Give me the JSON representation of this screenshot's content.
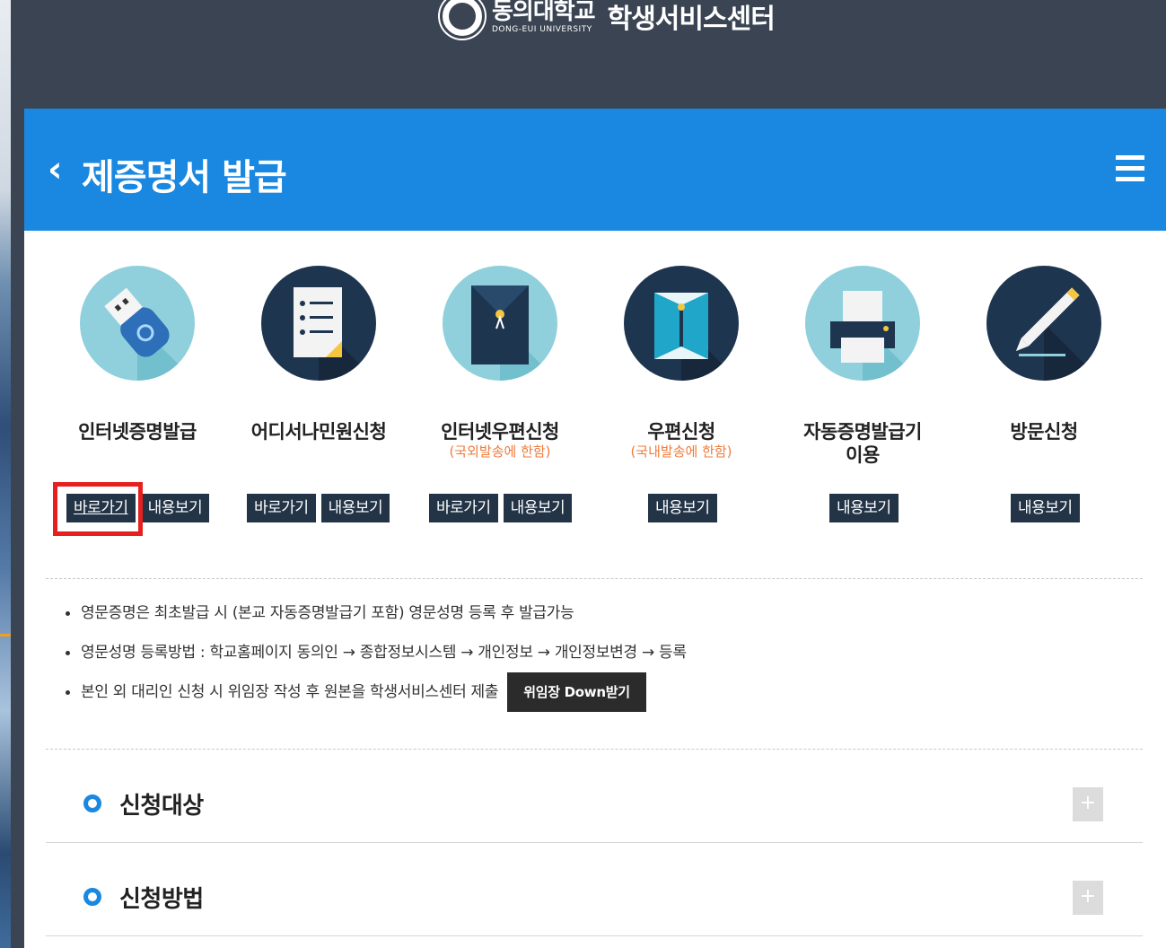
{
  "header": {
    "university_ko": "동의대학교",
    "university_en": "DONG-EUI UNIVERSITY",
    "center_name": "학생서비스센터"
  },
  "title_bar": {
    "title": "제증명서 발급"
  },
  "services": [
    {
      "name": "인터넷증명발급",
      "sub": "",
      "buttons": [
        "바로가기",
        "내용보기"
      ],
      "icon": "usb-drive-icon"
    },
    {
      "name": "어디서나민원신청",
      "sub": "",
      "buttons": [
        "바로가기",
        "내용보기"
      ],
      "icon": "document-list-icon"
    },
    {
      "name": "인터넷우편신청",
      "sub": "(국외발송에 한함)",
      "buttons": [
        "바로가기",
        "내용보기"
      ],
      "icon": "envelope-icon"
    },
    {
      "name": "우편신청",
      "sub": "(국내발송에 한함)",
      "buttons": [
        "내용보기"
      ],
      "icon": "open-envelope-icon"
    },
    {
      "name": "자동증명발급기 이용",
      "name_line1": "자동증명발급기",
      "name_line2": "이용",
      "sub": "",
      "buttons": [
        "내용보기"
      ],
      "icon": "printer-icon"
    },
    {
      "name": "방문신청",
      "sub": "",
      "buttons": [
        "내용보기"
      ],
      "icon": "pen-icon"
    }
  ],
  "notes": [
    "영문증명은 최초발급 시 (본교 자동증명발급기 포함) 영문성명 등록 후 발급가능",
    "영문성명 등록방법 : 학교홈페이지 동의인 → 종합정보시스템 → 개인정보 → 개인정보변경 → 등록",
    "본인 외 대리인 신청 시 위임장 작성 후 원본을 학생서비스센터 제출"
  ],
  "download_button": "위임장 Down받기",
  "accordions": [
    {
      "title": "신청대상",
      "toggle": "+"
    },
    {
      "title": "신청방법",
      "toggle": "+"
    }
  ],
  "colors": {
    "header_bg": "#3a4452",
    "title_bar_bg": "#1a88e0",
    "button_bg": "#243447",
    "sub_text": "#f07b3a",
    "highlight": "#e5201f"
  }
}
